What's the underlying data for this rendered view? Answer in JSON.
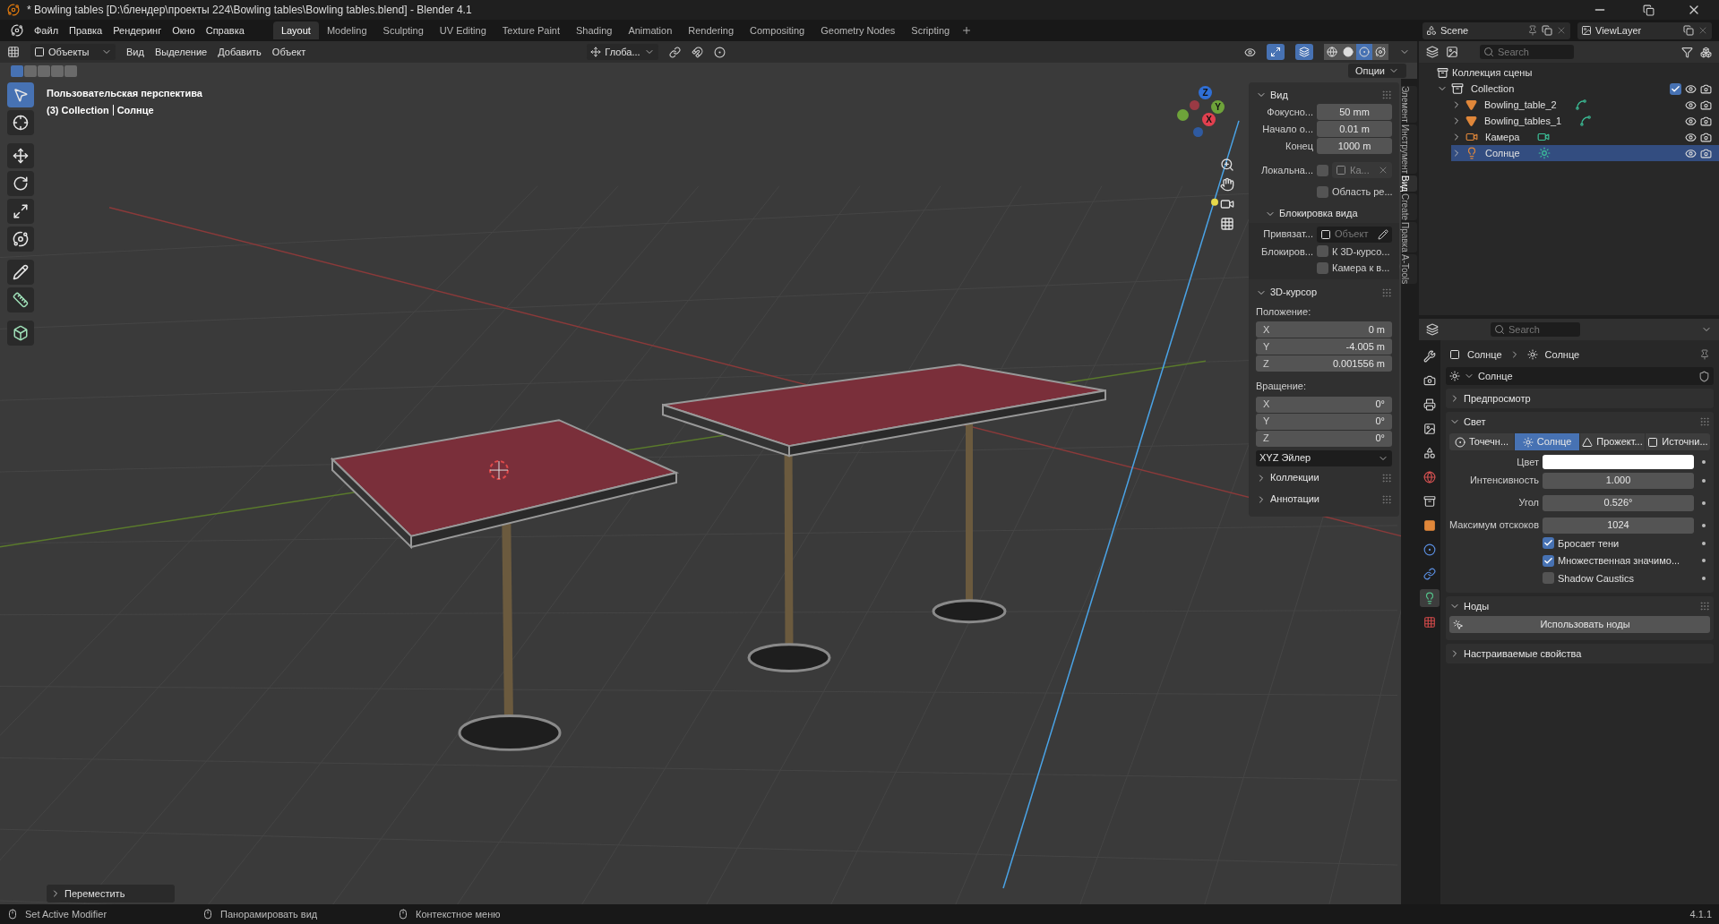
{
  "window": {
    "title": "* Bowling tables [D:\\блендер\\проекты 224\\Bowling tables\\Bowling tables.blend] - Blender 4.1"
  },
  "menu": [
    "Файл",
    "Правка",
    "Рендеринг",
    "Окно",
    "Справка"
  ],
  "workspaces": [
    {
      "label": "Layout",
      "selected": true
    },
    {
      "label": "Modeling",
      "selected": false
    },
    {
      "label": "Sculpting",
      "selected": false
    },
    {
      "label": "UV Editing",
      "selected": false
    },
    {
      "label": "Texture Paint",
      "selected": false
    },
    {
      "label": "Shading",
      "selected": false
    },
    {
      "label": "Animation",
      "selected": false
    },
    {
      "label": "Rendering",
      "selected": false
    },
    {
      "label": "Compositing",
      "selected": false
    },
    {
      "label": "Geometry Nodes",
      "selected": false
    },
    {
      "label": "Scripting",
      "selected": false
    }
  ],
  "scene_selector": {
    "scene": "Scene",
    "view_layer": "ViewLayer"
  },
  "viewport_header": {
    "mode": "Объекты",
    "menus": [
      "Вид",
      "Выделение",
      "Добавить",
      "Объект"
    ],
    "orientation": "Глоба...",
    "options": "Опции",
    "toggles": [
      {
        "kind": "gizmo",
        "on": true
      },
      {
        "kind": "overlay",
        "on": true
      }
    ],
    "shading": [
      {
        "kind": "wireframe",
        "selected": false
      },
      {
        "kind": "solid",
        "selected": false
      },
      {
        "kind": "material",
        "selected": true
      },
      {
        "kind": "rendered",
        "selected": false
      }
    ]
  },
  "select_modes": [
    {
      "selected": true
    },
    {
      "selected": false
    },
    {
      "selected": false
    },
    {
      "selected": false
    },
    {
      "selected": false
    }
  ],
  "tools": [
    {
      "kind": "select",
      "selected": true
    },
    {
      "kind": "cursor",
      "selected": false
    },
    {
      "kind": "move",
      "selected": false
    },
    {
      "kind": "rotate",
      "selected": false
    },
    {
      "kind": "scale",
      "selected": false
    },
    {
      "kind": "transform",
      "selected": false
    },
    {
      "kind": "annotate",
      "selected": false
    },
    {
      "kind": "measure",
      "selected": false
    },
    {
      "kind": "add-cube",
      "selected": false
    }
  ],
  "viewport_info": {
    "view_name": "Пользовательская перспектива",
    "context": "(3) Collection",
    "active": "Солнце"
  },
  "gizmo_axes": [
    {
      "label": "Z",
      "color": "#2f6fd6"
    },
    {
      "label": "Y",
      "color": "#6ea33a"
    },
    {
      "label": "X",
      "color": "#e2404f"
    }
  ],
  "last_operator": {
    "label": "Переместить",
    "expanded": false
  },
  "n_panel": {
    "tabs": [
      {
        "label": "Элемент",
        "selected": false
      },
      {
        "label": "Инструмент",
        "selected": false
      },
      {
        "label": "Вид",
        "selected": true
      },
      {
        "label": "Create",
        "selected": false
      },
      {
        "label": "Правка",
        "selected": false
      },
      {
        "label": "A-Tools",
        "selected": false
      }
    ],
    "view": {
      "title": "Вид",
      "expanded": true,
      "fields": [
        {
          "label": "Фокусно...",
          "value": "50 mm"
        },
        {
          "label": "Начало о...",
          "value": "0.01 m"
        },
        {
          "label": "Конец",
          "value": "1000 m"
        }
      ],
      "local_camera": {
        "label": "Локальна...",
        "checked": false,
        "value": "Ка..."
      },
      "render_region": {
        "label": "Область ре...",
        "checked": false
      },
      "lock": {
        "title": "Блокировка вида",
        "expanded": true,
        "object_label": "Привязат...",
        "object_placeholder": "Объект",
        "lock_label": "Блокиров...",
        "options": [
          {
            "label": "К 3D-курсо...",
            "checked": false
          },
          {
            "label": "Камера к в...",
            "checked": false
          }
        ]
      }
    },
    "cursor": {
      "title": "3D-курсор",
      "expanded": true,
      "location_label": "Положение:",
      "location": [
        {
          "axis": "X",
          "value": "0 m"
        },
        {
          "axis": "Y",
          "value": "-4.005 m"
        },
        {
          "axis": "Z",
          "value": "0.001556 m"
        }
      ],
      "rotation_label": "Вращение:",
      "rotation": [
        {
          "axis": "X",
          "value": "0°"
        },
        {
          "axis": "Y",
          "value": "0°"
        },
        {
          "axis": "Z",
          "value": "0°"
        }
      ],
      "rotation_mode": "XYZ Эйлер"
    },
    "more": [
      {
        "title": "Коллекции",
        "expanded": false
      },
      {
        "title": "Аннотации",
        "expanded": false
      }
    ]
  },
  "outliner": {
    "search_placeholder": "Search",
    "root": "Коллекция сцены",
    "tree": [
      {
        "name": "Collection",
        "kind": "collection",
        "expanded": true,
        "checked": true,
        "selected": false,
        "children": [
          {
            "name": "Bowling_table_2",
            "kind": "mesh",
            "expanded": false,
            "selected": false
          },
          {
            "name": "Bowling_tables_1",
            "kind": "mesh",
            "expanded": false,
            "selected": false
          },
          {
            "name": "Камера",
            "kind": "camera",
            "expanded": false,
            "selected": false
          },
          {
            "name": "Солнце",
            "kind": "light",
            "expanded": false,
            "selected": true
          }
        ]
      }
    ]
  },
  "properties": {
    "search_placeholder": "Search",
    "tabs": [
      {
        "kind": "tool",
        "selected": false
      },
      {
        "kind": "render",
        "selected": false
      },
      {
        "kind": "output",
        "selected": false
      },
      {
        "kind": "view-layer",
        "selected": false
      },
      {
        "kind": "scene",
        "selected": false
      },
      {
        "kind": "world",
        "selected": false
      },
      {
        "kind": "collection",
        "selected": false
      },
      {
        "kind": "object",
        "selected": false
      },
      {
        "kind": "physics",
        "selected": false
      },
      {
        "kind": "constraints",
        "selected": false
      },
      {
        "kind": "data",
        "selected": true
      },
      {
        "kind": "texture",
        "selected": false
      }
    ],
    "breadcrumb": [
      "Солнце",
      "Солнце"
    ],
    "datablock": "Солнце",
    "preview": {
      "title": "Предпросмотр",
      "expanded": false
    },
    "light": {
      "title": "Свет",
      "expanded": true,
      "types": [
        {
          "label": "Точечн...",
          "kind": "point",
          "selected": false
        },
        {
          "label": "Солнце",
          "kind": "sun",
          "selected": true
        },
        {
          "label": "Прожект...",
          "kind": "spot",
          "selected": false
        },
        {
          "label": "Источни...",
          "kind": "area",
          "selected": false
        }
      ],
      "color": {
        "label": "Цвет",
        "color": "#ffffff"
      },
      "fields": [
        {
          "label": "Интенсивность",
          "value": "1.000"
        },
        {
          "label": "Угол",
          "value": "0.526°"
        },
        {
          "label": "Максимум отскоков",
          "value": "1024"
        }
      ],
      "options": [
        {
          "label": "Бросает тени",
          "checked": true
        },
        {
          "label": "Множественная значимо...",
          "checked": true
        },
        {
          "label": "Shadow Caustics",
          "checked": false
        }
      ]
    },
    "nodes": {
      "title": "Ноды",
      "expanded": true,
      "button": "Использовать ноды"
    },
    "custom": {
      "title": "Настраиваемые свойства",
      "expanded": false
    }
  },
  "status_bar": {
    "hints": [
      "Set Active Modifier",
      "Панорамировать вид",
      "Контекстное меню"
    ],
    "version": "4.1.1"
  }
}
